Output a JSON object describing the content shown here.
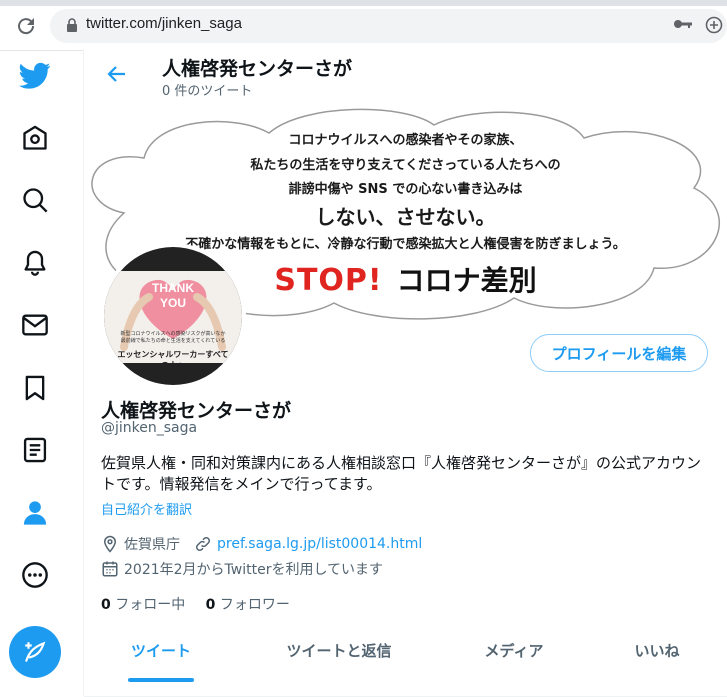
{
  "browser": {
    "url": "twitter.com/jinken_saga"
  },
  "header": {
    "title": "人権啓発センターさが",
    "tweet_count": "0 件のツイート"
  },
  "banner": {
    "line1": "コロナウイルスへの感染者やその家族、",
    "line2": "私たちの生活を守り支えてくださっている人たちへの",
    "line3": "誹謗中傷や SNS での心ない書き込みは",
    "line4": "しない、させない。",
    "line5": "不確かな情報をもとに、冷静な行動で感染拡大と人権侵害を防ぎましょう。",
    "stop": "STOP!",
    "discrimination": "コロナ差別"
  },
  "avatar": {
    "heart_text_1": "THANK",
    "heart_text_2": "YOU",
    "small_text_1": "新型コロナウイルスへの感染リスクが高いなか",
    "small_text_2": "最前線で私たちの命と生活を支えてくれている",
    "caption": "エッセンシャルワーカーすべての人へ"
  },
  "profile": {
    "edit_label": "プロフィールを編集",
    "name": "人権啓発センターさが",
    "handle": "@jinken_saga",
    "bio": "佐賀県人権・同和対策課内にある人権相談窓口『人権啓発センターさが』の公式アカウントです。情報発信をメインで行ってます。",
    "translate_label": "自己紹介を翻訳",
    "location": "佐賀県庁",
    "link": "pref.saga.lg.jp/list00014.html",
    "joined": "2021年2月からTwitterを利用しています",
    "following_count": "0",
    "following_label": "フォロー中",
    "followers_count": "0",
    "followers_label": "フォロワー"
  },
  "tabs": [
    {
      "label": "ツイート"
    },
    {
      "label": "ツイートと返信"
    },
    {
      "label": "メディア"
    },
    {
      "label": "いいね"
    }
  ],
  "colors": {
    "accent": "#1d9bf0",
    "stop_red": "#e0241f"
  }
}
